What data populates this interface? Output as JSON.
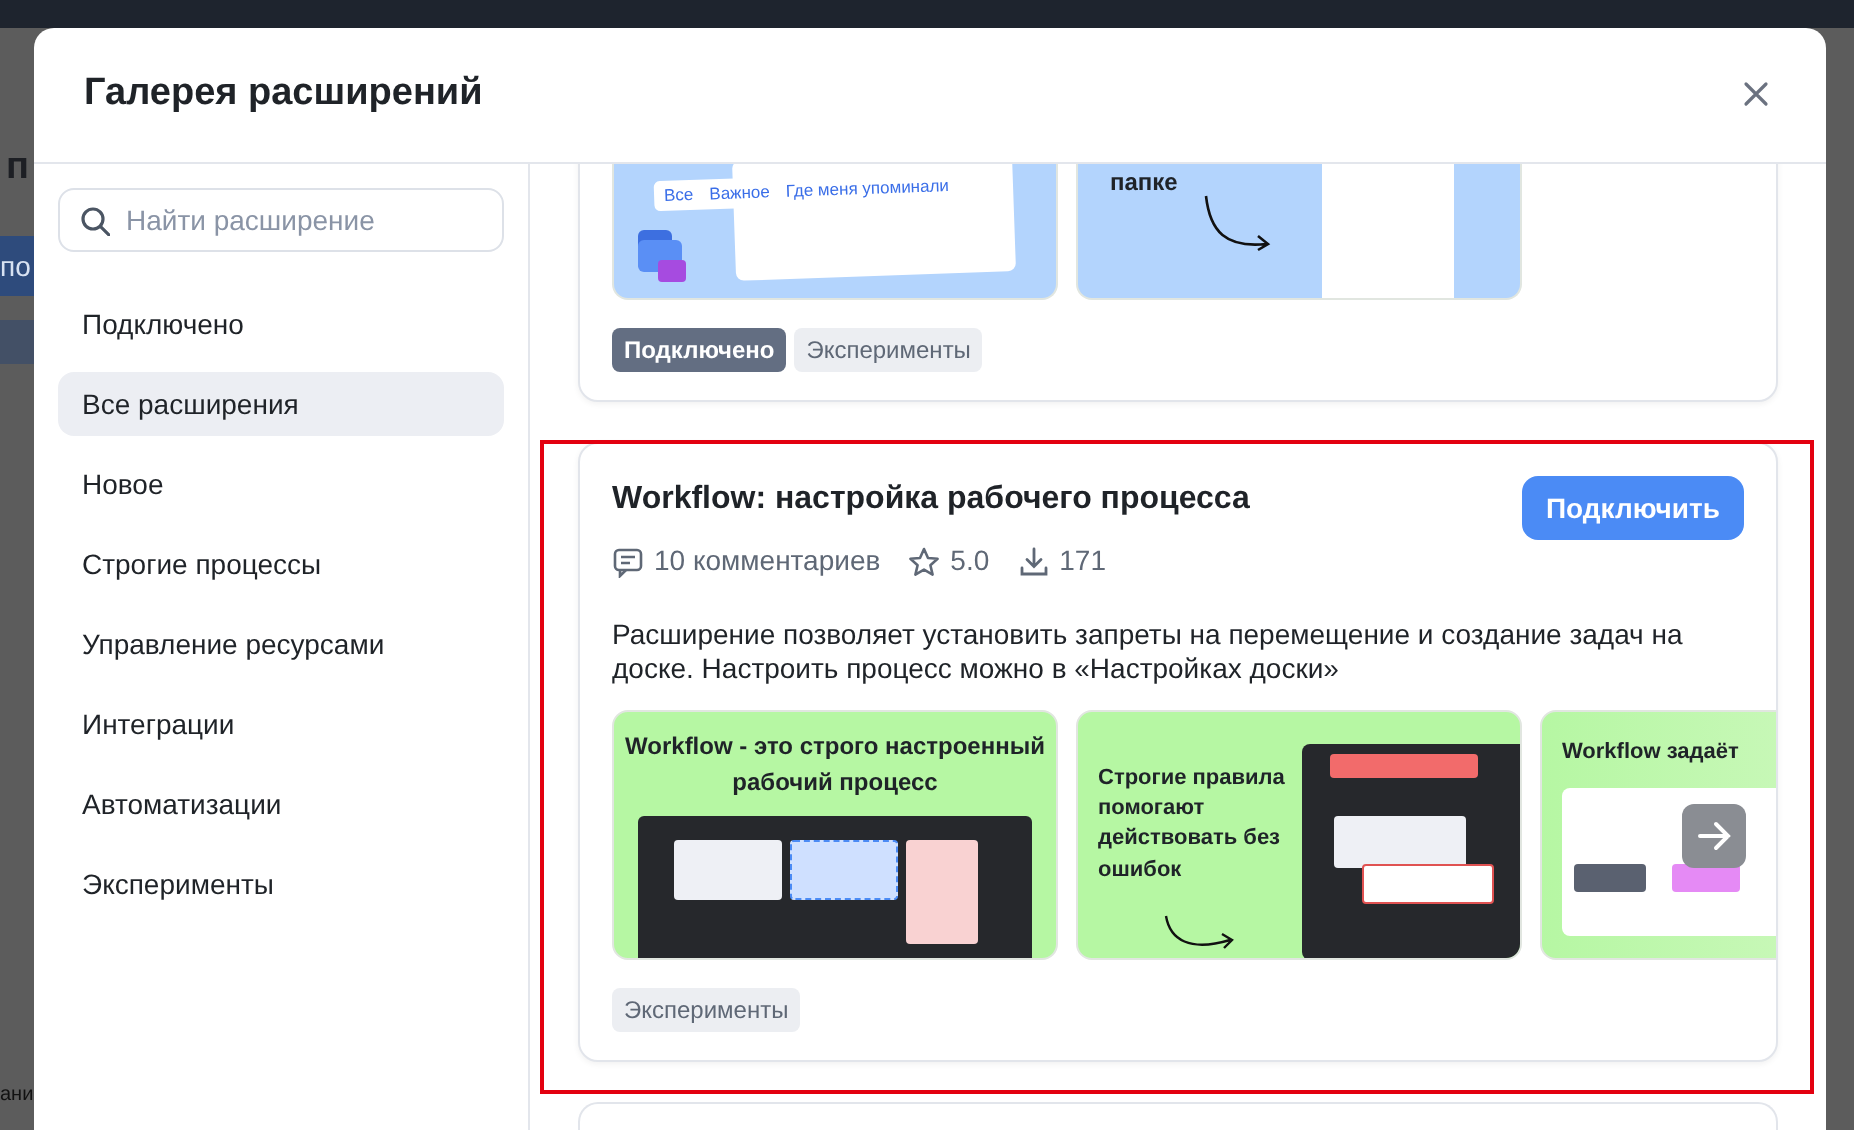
{
  "backdrop": {
    "heading": "п",
    "button": "по",
    "footer": "ани"
  },
  "dialog": {
    "title": "Галерея расширений"
  },
  "search": {
    "placeholder": "Найти расширение"
  },
  "categories": [
    {
      "label": "Подключено",
      "selected": false
    },
    {
      "label": "Все расширения",
      "selected": true
    },
    {
      "label": "Новое",
      "selected": false
    },
    {
      "label": "Строгие процессы",
      "selected": false
    },
    {
      "label": "Управление ресурсами",
      "selected": false
    },
    {
      "label": "Интеграции",
      "selected": false
    },
    {
      "label": "Автоматизации",
      "selected": false
    },
    {
      "label": "Эксперименты",
      "selected": false
    }
  ],
  "extensions": [
    {
      "highlighted": false,
      "previews": [
        {
          "kind": "mentions",
          "texts": [
            "Все",
            "Важное",
            "Где меня упоминали"
          ]
        },
        {
          "kind": "checklist",
          "texts": [
            "папке"
          ]
        }
      ],
      "tags": [
        {
          "label": "Подключено",
          "kind": "connected"
        },
        {
          "label": "Эксперименты",
          "kind": "plain"
        }
      ]
    },
    {
      "highlighted": true,
      "title": "Workflow: настройка рабочего процесса",
      "comments": "10 комментариев",
      "rating": "5.0",
      "downloads": "171",
      "button": "Подключить",
      "description": "Расширение позволяет установить запреты на перемещение и создание задач на доске. Настроить процесс можно в «Настройках доски»",
      "previews": [
        {
          "kind": "board",
          "texts": [
            "Workflow - это строго настроенный рабочий процесс"
          ]
        },
        {
          "kind": "rules",
          "texts": [
            "Строгие правила помогают действовать без ошибок"
          ]
        },
        {
          "kind": "flow",
          "texts": [
            "Workflow задаёт"
          ]
        }
      ],
      "tags": [
        {
          "label": "Эксперименты",
          "kind": "plain"
        }
      ]
    }
  ]
}
